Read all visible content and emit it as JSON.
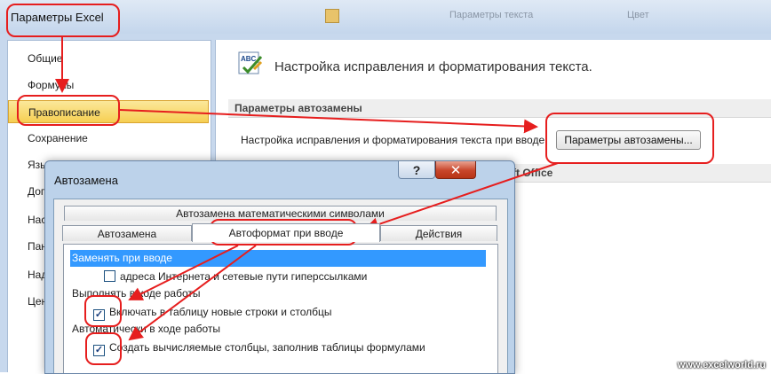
{
  "excel_window": {
    "title": "Параметры Excel",
    "ribbon_hints": [
      "Параметры текста",
      "Цвет"
    ],
    "sidebar": {
      "items": [
        {
          "label": "Общие"
        },
        {
          "label": "Формулы"
        },
        {
          "label": "Правописание",
          "selected": true
        },
        {
          "label": "Сохранение"
        },
        {
          "label": "Язык"
        },
        {
          "label": "Дополнительно"
        },
        {
          "label": "Настройка"
        },
        {
          "label": "Панель"
        },
        {
          "label": "Надстройки"
        },
        {
          "label": "Центр"
        }
      ]
    },
    "content": {
      "icon": "abc-spellcheck-icon",
      "title": "Настройка исправления и форматирования текста.",
      "section_autocorrect": "Параметры автозамены",
      "autocorrect_label": "Настройка исправления и форматирования текста при вводе:",
      "autocorrect_button": "Параметры автозамены...",
      "section_office_tail": "ft Office"
    }
  },
  "autocorrect_dialog": {
    "title": "Автозамена",
    "help_button": "?",
    "close_icon": "close-icon",
    "tabs": {
      "math": "Автозамена математическими символами",
      "autocorrect": "Автозамена",
      "autoformat": "Автоформат при вводе",
      "actions": "Действия"
    },
    "active_tab": "autoformat",
    "replace_header": "Заменять при вводе",
    "option_internet": "адреса Интернета и сетевые пути гиперссылками",
    "apply_header": "Выполнять в ходе работы",
    "option_include_rows": "Включать в таблицу новые строки и столбцы",
    "auto_header": "Автоматически в ходе работы",
    "option_calc_columns": "Создать вычисляемые столбцы, заполнив таблицы формулами",
    "checkboxes": {
      "internet": false,
      "include_rows": true,
      "calc_columns": true
    }
  },
  "annotation_color": "#e61e1e",
  "watermark": "www.excelworld.ru"
}
